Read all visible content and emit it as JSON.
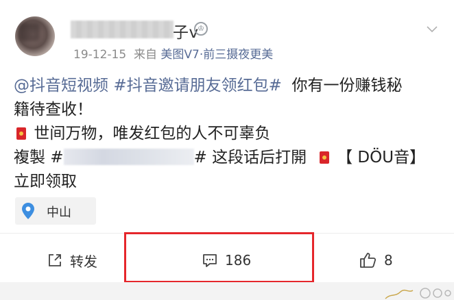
{
  "header": {
    "username_visible_suffix": "子v",
    "vip_badge_glyph": "♔",
    "timestamp": "19-12-15",
    "source_prefix": "来自",
    "source_device": "美图V7·前三摄夜更美"
  },
  "post": {
    "tag1": "@抖音短视频",
    "tag2": "#抖音邀请朋友领红包#",
    "line1_text": "你有一份赚钱秘",
    "line2_text": "籍待查收！",
    "line3_text": "世间万物，唯发红包的人不可辜负",
    "line4_prefix": "複製 #",
    "line4_mid": "# 这段话后打開",
    "line4_bracket": "【 DÖU音】",
    "line5_text": "立即领取"
  },
  "location": {
    "label": "中山"
  },
  "actions": {
    "repost_label": "转发",
    "comment_count": "186",
    "like_count": "8"
  },
  "colors": {
    "link": "#576b95",
    "highlight_border": "#e5262b",
    "red_packet": "#d9262a"
  }
}
